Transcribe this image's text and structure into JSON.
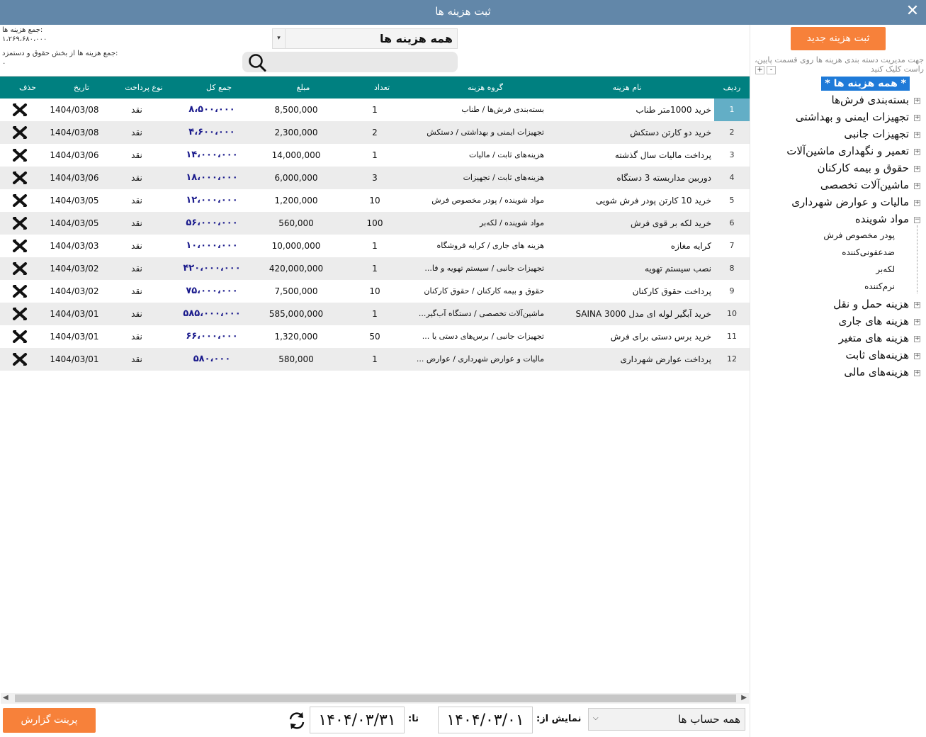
{
  "window": {
    "title": "ثبت هزینه ها"
  },
  "summary": {
    "total_label": "جمع هزینه ها:",
    "total_value": "۱،۲۶۹،۶۸۰،۰۰۰",
    "salary_label": "جمع هزینه ها از بخش حقوق و دستمزد:",
    "salary_value": "۰"
  },
  "filter": {
    "category_value": "همه هزینه ها",
    "search_placeholder": ""
  },
  "table": {
    "headers": {
      "row": "ردیف",
      "name": "نام هزینه",
      "group": "گروه هزینه",
      "qty": "تعداد",
      "price": "مبلغ",
      "total": "جمع کل",
      "ptype": "نوع پرداخت",
      "date": "تاریخ",
      "del": "حذف"
    },
    "rows": [
      {
        "idx": "1",
        "name": "خرید 1000متر طناب",
        "group": "بسته‌بندی فرش‌ها / طناب",
        "qty": "1",
        "price": "8,500,000",
        "total": "۸،۵۰۰،۰۰۰",
        "ptype": "نقد",
        "date": "1404/03/08"
      },
      {
        "idx": "2",
        "name": "خرید دو کارتن دستکش",
        "group": "تجهیزات ایمنی و بهداشتی / دستکش",
        "qty": "2",
        "price": "2,300,000",
        "total": "۴،۶۰۰،۰۰۰",
        "ptype": "نقد",
        "date": "1404/03/08"
      },
      {
        "idx": "3",
        "name": "پرداخت مالیات سال گذشته",
        "group": "هزینه‌های ثابت / مالیات",
        "qty": "1",
        "price": "14,000,000",
        "total": "۱۴،۰۰۰،۰۰۰",
        "ptype": "نقد",
        "date": "1404/03/06"
      },
      {
        "idx": "4",
        "name": "دوربین مداربسته 3 دستگاه",
        "group": "هزینه‌های ثابت /  تجهیزات",
        "qty": "3",
        "price": "6,000,000",
        "total": "۱۸،۰۰۰،۰۰۰",
        "ptype": "نقد",
        "date": "1404/03/06"
      },
      {
        "idx": "5",
        "name": "خرید 10 کارتن پودر فرش شویی",
        "group": "مواد شوینده / پودر مخصوص فرش",
        "qty": "10",
        "price": "1,200,000",
        "total": "۱۲،۰۰۰،۰۰۰",
        "ptype": "نقد",
        "date": "1404/03/05"
      },
      {
        "idx": "6",
        "name": "خرید لکه بر قوی فرش",
        "group": "مواد شوینده / لکه‌بر",
        "qty": "100",
        "price": "560,000",
        "total": "۵۶،۰۰۰،۰۰۰",
        "ptype": "نقد",
        "date": "1404/03/05"
      },
      {
        "idx": "7",
        "name": "کرایه مغازه",
        "group": "هزینه های جاری / کرایه فروشگاه",
        "qty": "1",
        "price": "10,000,000",
        "total": "۱۰،۰۰۰،۰۰۰",
        "ptype": "نقد",
        "date": "1404/03/03"
      },
      {
        "idx": "8",
        "name": "نصب سیستم تهویه",
        "group": "تجهیزات جانبی / سیستم تهویه و فا...",
        "qty": "1",
        "price": "420,000,000",
        "total": "۴۲۰،۰۰۰،۰۰۰",
        "ptype": "نقد",
        "date": "1404/03/02"
      },
      {
        "idx": "9",
        "name": "پرداخت حقوق کارکنان",
        "group": "حقوق و بیمه کارکنان / حقوق کارکنان",
        "qty": "10",
        "price": "7,500,000",
        "total": "۷۵،۰۰۰،۰۰۰",
        "ptype": "نقد",
        "date": "1404/03/02"
      },
      {
        "idx": "10",
        "name": "خرید آبگیر لوله ای مدل SAINA 3000",
        "group": "ماشین‌آلات تخصصی / دستگاه آب‌گیر...",
        "qty": "1",
        "price": "585,000,000",
        "total": "۵۸۵،۰۰۰،۰۰۰",
        "ptype": "نقد",
        "date": "1404/03/01"
      },
      {
        "idx": "11",
        "name": "خرید برس دستی برای فرش",
        "group": "تجهیزات جانبی / برس‌های دستی یا ...",
        "qty": "50",
        "price": "1,320,000",
        "total": "۶۶،۰۰۰،۰۰۰",
        "ptype": "نقد",
        "date": "1404/03/01"
      },
      {
        "idx": "12",
        "name": "پرداخت عوارض شهرداری",
        "group": "مالیات و عوارض شهرداری / عوارض ...",
        "qty": "1",
        "price": "580,000",
        "total": "۵۸۰،۰۰۰",
        "ptype": "نقد",
        "date": "1404/03/01"
      }
    ]
  },
  "sidebar": {
    "new_button": "ثبت هزینه جدید",
    "hint": "جهت مدیریت دسته بندی هزینه ها روی قسمت پایین، راست کلیک کنید",
    "plus": "+",
    "minus": "-",
    "tree_all": "* همه هزینه ها *",
    "nodes": [
      "بسته‌بندی فرش‌ها",
      "تجهیزات ایمنی و بهداشتی",
      "تجهیزات جانبی",
      "تعمیر و نگهداری ماشین‌آلات",
      "حقوق و بیمه کارکنان",
      "ماشین‌آلات تخصصی",
      "مالیات و عوارض شهرداری",
      "مواد شوینده",
      "هزینه حمل و نقل",
      "هزینه های جاری",
      "هزینه های متغیر",
      "هزینه‌های ثابت",
      "هزینه‌های مالی"
    ],
    "children": [
      "پودر مخصوص فرش",
      "ضدعفونی‌کننده",
      "لکه‌بر",
      "نرم‌کننده"
    ]
  },
  "footer": {
    "print_button": "پرینت گزارش",
    "to_label": "تا:",
    "to_date": "۱۴۰۴/۰۳/۳۱",
    "from_label": "نمایش از:",
    "from_date": "۱۴۰۴/۰۳/۰۱",
    "account_value": "همه حساب ها"
  },
  "colors": {
    "titlebar": "#6287a9",
    "header": "#008080",
    "accent": "#f7813a",
    "selected": "#1e7ad8"
  }
}
